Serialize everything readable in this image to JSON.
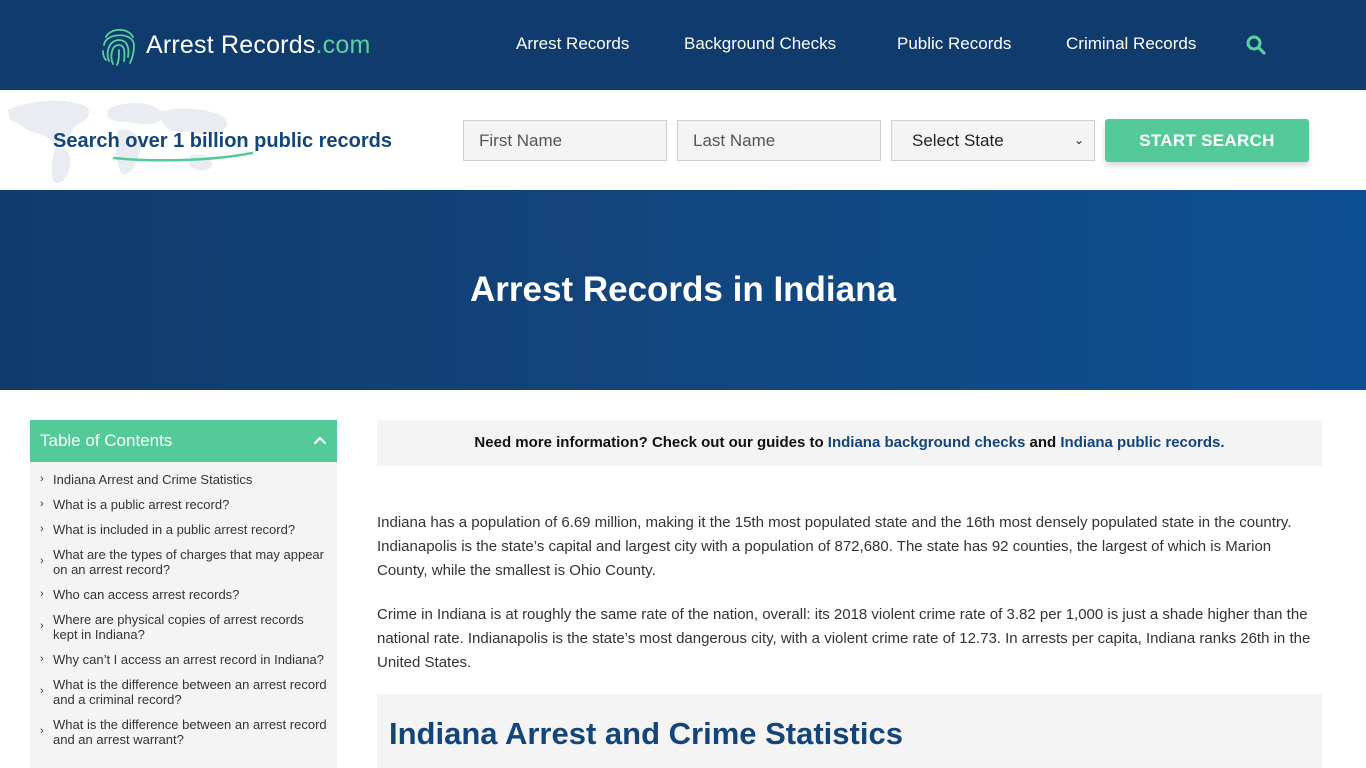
{
  "header": {
    "logo_main": "Arrest Records",
    "logo_suffix": ".com",
    "nav": [
      {
        "label": "Arrest Records"
      },
      {
        "label": "Background Checks"
      },
      {
        "label": "Public Records"
      },
      {
        "label": "Criminal Records"
      }
    ],
    "search_icon": "search-icon"
  },
  "search": {
    "tagline": "Search over 1 billion public records",
    "first_name_placeholder": "First Name",
    "last_name_placeholder": "Last Name",
    "state_selected": "Select State",
    "button_label": "START SEARCH"
  },
  "hero": {
    "title": "Arrest Records in Indiana"
  },
  "toc": {
    "title": "Table of Contents",
    "items": [
      "Indiana Arrest and Crime Statistics",
      "What is a public arrest record?",
      "What is included in a public arrest record?",
      "What are the types of charges that may appear on an arrest record?",
      "Who can access arrest records?",
      "Where are physical copies of arrest records kept in Indiana?",
      "Why can’t I access an arrest record in Indiana?",
      "What is the difference between an arrest record and a criminal record?",
      "What is the difference between an arrest record and an arrest warrant?"
    ]
  },
  "notice": {
    "prefix": "Need more information? Check out our guides to ",
    "link1": "Indiana background checks",
    "middle": " and ",
    "link2": "Indiana public records."
  },
  "content": {
    "paragraph1": "Indiana has a population of 6.69 million, making it the 15th most populated state and the 16th most densely populated state in the country. Indianapolis is the state’s capital and largest city with a population of 872,680. The state has 92 counties, the largest of which is Marion County, while the smallest is Ohio County.",
    "paragraph2": "Crime in Indiana is at roughly the same rate of the nation, overall: its 2018 violent crime rate of 3.82 per 1,000 is just a shade higher than the national rate. Indianapolis is the state’s most dangerous city, with a violent crime rate of 12.73. In arrests per capita, Indiana ranks 26th in the United States.",
    "section_heading": "Indiana Arrest and Crime Statistics"
  },
  "colors": {
    "navy": "#0f3c6c",
    "accent_green": "#54c99a",
    "link_blue": "#13457a"
  }
}
